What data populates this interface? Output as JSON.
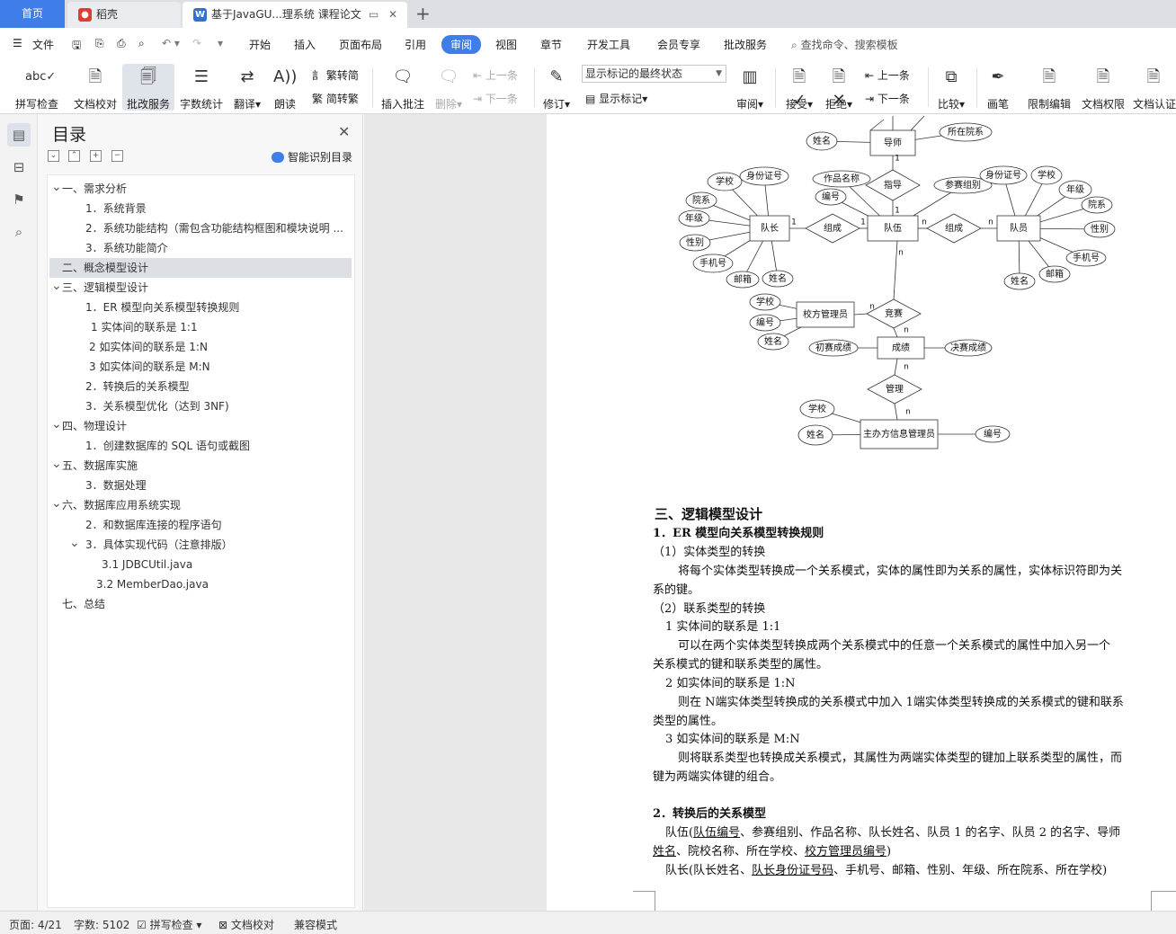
{
  "tabs": {
    "home": "首页",
    "daoke": "稻壳",
    "doc": "基于JavaGU...理系统 课程论文"
  },
  "menu": {
    "file": "文件",
    "items": [
      "开始",
      "插入",
      "页面布局",
      "引用",
      "审阅",
      "视图",
      "章节",
      "开发工具",
      "会员专享",
      "批改服务"
    ],
    "active": "审阅",
    "search": "查找命令、搜索模板"
  },
  "ribbon": {
    "spell": "拼写检查",
    "proof": "文档校对",
    "correct": "批改服务",
    "wordcount": "字数统计",
    "translate": "翻译",
    "read": "朗读",
    "t2s": "繁转简",
    "s2t": "简转繁",
    "insert_comment": "插入批注",
    "delete": "删除",
    "prev": "上一条",
    "next": "下一条",
    "revise": "修订",
    "markup_state": "显示标记的最终状态",
    "show_markup": "显示标记",
    "review": "审阅",
    "accept": "接受",
    "reject": "拒绝",
    "prev2": "上一条",
    "next2": "下一条",
    "compare": "比较",
    "pen": "画笔",
    "restrict": "限制编辑",
    "perm": "文档权限",
    "cert": "文档认证"
  },
  "toc": {
    "title": "目录",
    "smart": "智能识别目录",
    "items": [
      {
        "text": "一、需求分析",
        "level": 0,
        "chev": "down"
      },
      {
        "text": "1．系统背景",
        "level": 1
      },
      {
        "text": "2．系统功能结构（需包含功能结构框图和模块说明 ...",
        "level": 1
      },
      {
        "text": "3．系统功能简介",
        "level": 1
      },
      {
        "text": "二、概念模型设计",
        "level": 0,
        "selected": true
      },
      {
        "text": "三、逻辑模型设计",
        "level": 0,
        "chev": "down"
      },
      {
        "text": "1．ER 模型向关系模型转换规则",
        "level": 1
      },
      {
        "text": "1 实体间的联系是 1:1",
        "level": 2
      },
      {
        "text": "2 如实体间的联系是 1:N",
        "level": 3
      },
      {
        "text": "3 如实体间的联系是 M:N",
        "level": 3
      },
      {
        "text": "2．转换后的关系模型",
        "level": 1
      },
      {
        "text": "3．关系模型优化（达到 3NF)",
        "level": 1
      },
      {
        "text": "四、物理设计",
        "level": 0,
        "chev": "down"
      },
      {
        "text": "1．创建数据库的 SQL 语句或截图",
        "level": 1
      },
      {
        "text": "五、数据库实施",
        "level": 0,
        "chev": "down"
      },
      {
        "text": "3．数据处理",
        "level": 1
      },
      {
        "text": "六、数据库应用系统实现",
        "level": 0,
        "chev": "down"
      },
      {
        "text": "2．和数据库连接的程序语句",
        "level": 1
      },
      {
        "text": "3．具体实现代码（注意排版）",
        "level": 1,
        "chev": "down"
      },
      {
        "text": "3.1 JDBCUtil.java",
        "level": 4
      },
      {
        "text": "3.2 MemberDao.java",
        "level": 5
      },
      {
        "text": "七、总结",
        "level": 0
      }
    ]
  },
  "er": {
    "entities": [
      "导师",
      "队长",
      "队伍",
      "队员",
      "校方管理员",
      "成绩",
      "主办方信息管理员"
    ],
    "relations": [
      "指导",
      "组成",
      "组成",
      "竞赛",
      "管理"
    ],
    "attributes": [
      "姓名",
      "所在院系",
      "作品名称",
      "编号",
      "参赛组别",
      "学校",
      "身份证号",
      "院系",
      "年级",
      "性别",
      "手机号",
      "邮箱",
      "姓名",
      "身份证号",
      "学校",
      "年级",
      "院系",
      "性别",
      "手机号",
      "邮箱",
      "姓名",
      "学校",
      "编号",
      "姓名",
      "初赛成绩",
      "决赛成绩",
      "学校",
      "姓名",
      "编号"
    ],
    "cardinality": [
      "1",
      "1",
      "1",
      "1",
      "n",
      "n",
      "n",
      "n",
      "n",
      "n",
      "n"
    ]
  },
  "doc": {
    "h_logic": "三、逻辑模型设计",
    "h_rule": "1．ER 模型向关系模型转换规则",
    "p1": "（1）实体类型的转换",
    "p2a": "将每个实体类型转换成一个关系模式，实体的属性即为关系的属性，实体标识符即为关",
    "p2b": "系的键。",
    "p3": "（2）联系类型的转换",
    "p4": "1 实体间的联系是 1:1",
    "p5a": "可以在两个实体类型转换成两个关系模式中的任意一个关系模式的属性中加入另一个",
    "p5b": "关系模式的键和联系类型的属性。",
    "p6": "2 如实体间的联系是 1:N",
    "p7a": "则在 N端实体类型转换成的关系模式中加入 1端实体类型转换成的关系模式的键和联系",
    "p7b": "类型的属性。",
    "p8": "3 如实体间的联系是 M:N",
    "p9a": "则将联系类型也转换成关系模式，其属性为两端实体类型的键加上联系类型的属性，而",
    "p9b": "键为两端实体键的组合。",
    "h_trans": "2．转换后的关系模型",
    "team_prefix": "队伍(",
    "team_u1": "队伍编号",
    "team_mid": "、参赛组别、作品名称、队长姓名、队员 1 的名字、队员 2 的名字、导师",
    "team_line2a": "姓名",
    "team_line2b": "、院校名称、所在学校、",
    "team_u2": "校方管理员编号",
    "team_line2c": ")",
    "cap_prefix": "队长(队长姓名、",
    "cap_u": "队长身份证号码",
    "cap_rest": "、手机号、邮箱、性别、年级、所在院系、所在学校)"
  },
  "status": {
    "page": "页面: 4/21",
    "words": "字数: 5102",
    "spell": "拼写检查",
    "proof": "文档校对",
    "compat": "兼容模式"
  }
}
